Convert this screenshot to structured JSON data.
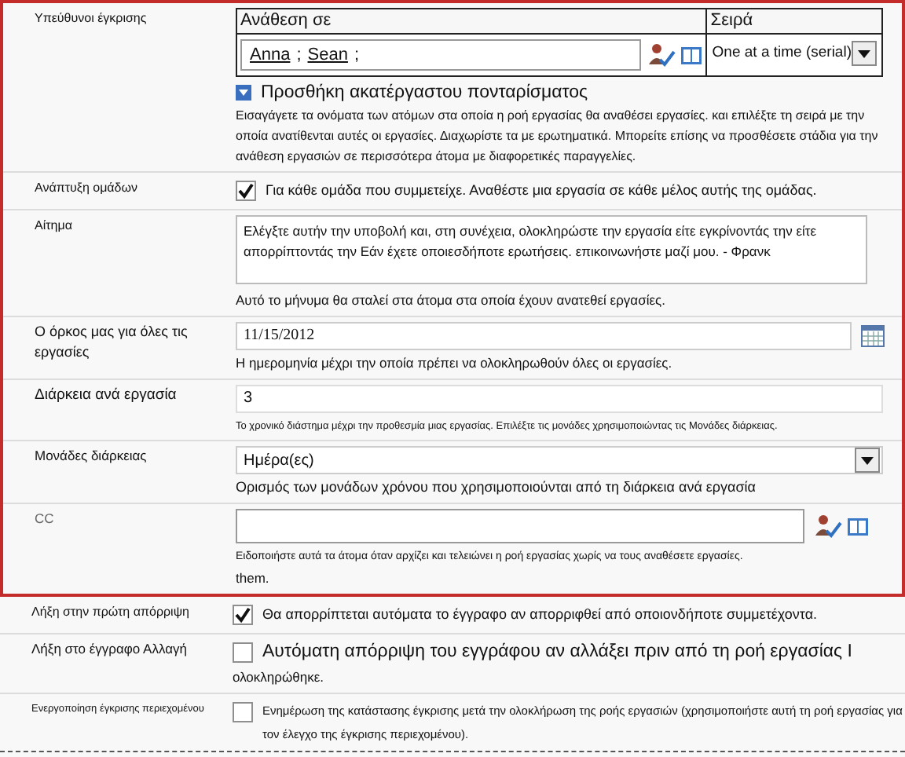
{
  "highlighted_rows": [
    {
      "kind": "approvers",
      "label": "Υπεύθυνοι έγκρισης",
      "assign_header": "Ανάθεση σε",
      "order_header": "Σειρά",
      "people": [
        "Anna",
        "Sean"
      ],
      "separator": ";",
      "order_value": "One at a time (serial)",
      "add_stage_link": "Προσθήκη ακατέργαστου πονταρίσματος",
      "help": "Εισαγάγετε τα ονόματα των ατόμων στα οποία η ροή εργασίας θα αναθέσει εργασίες. και επιλέξτε τη σειρά με την οποία ανατίθενται αυτές οι εργασίες. Διαχωρίστε τα με ερωτηματικά. Μπορείτε επίσης να προσθέσετε στάδια για την ανάθεση εργασιών σε περισσότερα άτομα με διαφορετικές παραγγελίες."
    },
    {
      "kind": "checkbox",
      "label": "Ανάπτυξη ομάδων",
      "checked": true,
      "text": "Για κάθε ομάδα που συμμετείχε. Αναθέστε μια εργασία σε κάθε μέλος αυτής της ομάδας."
    },
    {
      "kind": "textarea",
      "label": "Αίτημα",
      "value": "Ελέγξτε αυτήν την υποβολή και, στη συνέχεια, ολοκληρώστε την εργασία είτε εγκρίνοντάς την είτε απορρίπτοντάς την Εάν έχετε οποιεσδήποτε ερωτήσεις. επικοινωνήστε μαζί μου. - Φρανκ",
      "help": "Αυτό το μήνυμα θα σταλεί στα άτομα στα οποία έχουν ανατεθεί εργασίες."
    },
    {
      "kind": "date",
      "label": "Ο όρκος μας για όλες τις εργασίες",
      "value": "11/15/2012",
      "help": "Η ημερομηνία μέχρι την οποία πρέπει να ολοκληρωθούν όλες οι εργασίες."
    },
    {
      "kind": "text",
      "label": "Διάρκεια ανά εργασία",
      "value": "3",
      "help": "Το χρονικό διάστημα μέχρι την προθεσμία μιας εργασίας. Επιλέξτε τις μονάδες χρησιμοποιώντας τις Μονάδες διάρκειας."
    },
    {
      "kind": "select",
      "label": "Μονάδες διάρκειας",
      "value": "Ημέρα(ες)",
      "help": "Ορισμός των μονάδων χρόνου που χρησιμοποιούνται από τη διάρκεια ανά εργασία"
    },
    {
      "kind": "people",
      "label": "CC",
      "help": "Ειδοποιήστε αυτά τα άτομα όταν αρχίζει και τελειώνει η ροή εργασίας χωρίς να τους αναθέσετε εργασίες.",
      "extra": "them."
    }
  ],
  "rows": [
    {
      "kind": "checkbox",
      "label": "Λήξη στην πρώτη απόρριψη",
      "checked": true,
      "text": "Θα απορρίπτεται αυτόματα το έγγραφο αν απορριφθεί από οποιονδήποτε συμμετέχοντα."
    },
    {
      "kind": "checkbox_wrap",
      "label": "Λήξη στο έγγραφο Αλλαγή",
      "checked": false,
      "text": "Αυτόματη απόρριψη του εγγράφου αν αλλάξει πριν από τη ροή εργασίας Ι",
      "extra": "ολοκληρώθηκε."
    },
    {
      "kind": "checkbox_small",
      "label": "Ενεργοποίηση έγκρισης περιεχομένου",
      "checked": false,
      "text": "Ενημέρωση της κατάστασης έγκρισης μετά την ολοκλήρωση της ροής εργασιών (χρησιμοποιήστε αυτή τη ροή εργασίας για τον έλεγχο της έγκρισης περιεχομένου)."
    }
  ]
}
